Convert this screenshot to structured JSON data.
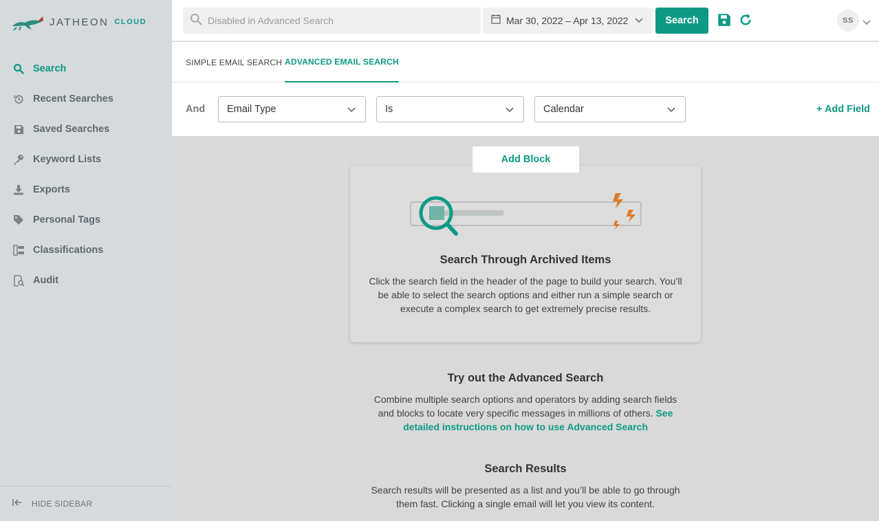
{
  "brand": {
    "name": "JATHEON",
    "suffix": "CLOUD"
  },
  "sidebar": {
    "items": [
      {
        "label": "Search",
        "icon": "search-icon"
      },
      {
        "label": "Recent Searches",
        "icon": "history-icon"
      },
      {
        "label": "Saved Searches",
        "icon": "save-icon"
      },
      {
        "label": "Keyword Lists",
        "icon": "key-icon"
      },
      {
        "label": "Exports",
        "icon": "download-icon"
      },
      {
        "label": "Personal Tags",
        "icon": "tag-icon"
      },
      {
        "label": "Classifications",
        "icon": "classification-icon"
      },
      {
        "label": "Audit",
        "icon": "audit-icon"
      }
    ],
    "active_index": 0,
    "hide_label": "HIDE SIDEBAR"
  },
  "header": {
    "search_placeholder": "Disabled in Advanced Search",
    "date_range": "Mar 30, 2022 – Apr 13, 2022",
    "search_button": "Search",
    "user_initials": "SS"
  },
  "tabs": [
    {
      "label": "SIMPLE EMAIL SEARCH",
      "active": false
    },
    {
      "label": "ADVANCED EMAIL SEARCH",
      "active": true
    }
  ],
  "criteria": {
    "operator": "And",
    "field": "Email Type",
    "condition": "Is",
    "value": "Calendar",
    "add_field": "+ Add Field"
  },
  "main": {
    "add_block": "Add Block",
    "card": {
      "title": "Search Through Archived Items",
      "body": "Click the search field in the header of the page to build your search. You’ll be able to select the search options and either run a simple search or execute a complex search to get extremely precise results."
    },
    "advanced": {
      "title": "Try out the Advanced Search",
      "body": "Combine multiple search options and operators by adding search fields and blocks to locate very specific messages in millions of others.",
      "link": "See detailed instructions on how to use Advanced Search"
    },
    "results": {
      "title": "Search Results",
      "body": "Search results will be presented as a list and you’ll be able to go through them fast. Clicking a single email will let you view its content."
    }
  },
  "colors": {
    "accent": "#0d9a85",
    "sidebar_bg": "#d6dadd",
    "main_bg": "#d9d9d9",
    "lightning": "#e07b25"
  }
}
